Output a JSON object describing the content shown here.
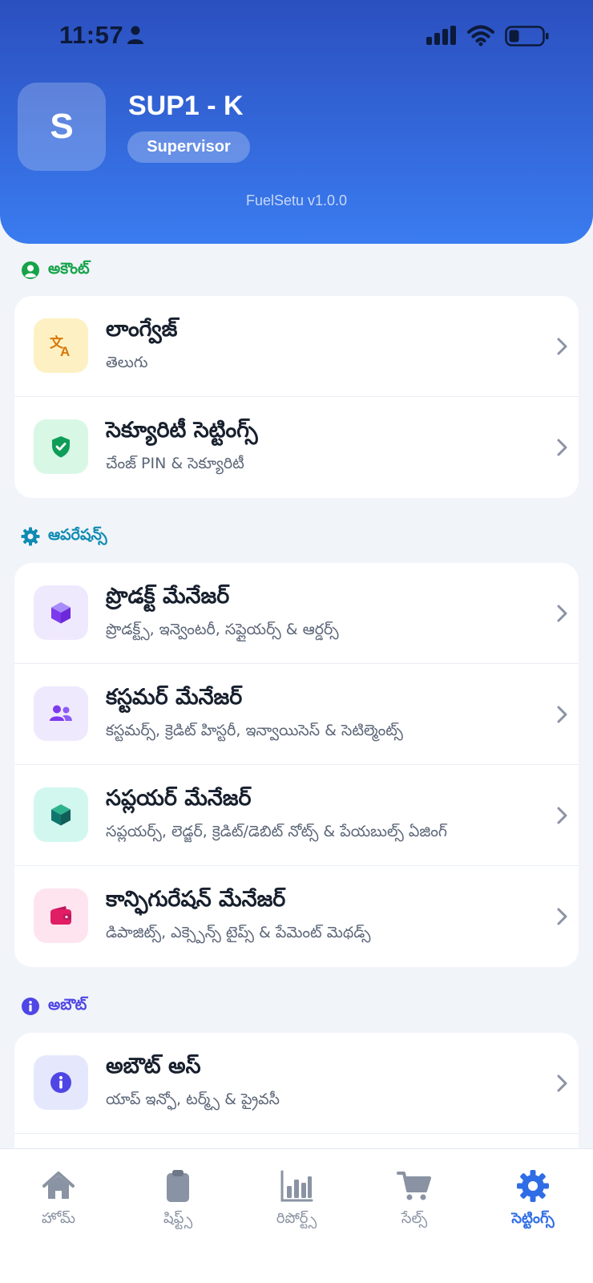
{
  "status_bar": {
    "time": "11:57"
  },
  "profile": {
    "initial": "S",
    "name": "SUP1 - K",
    "role": "Supervisor",
    "version": "FuelSetu v1.0.0"
  },
  "sections": {
    "account": {
      "title": "అకౌంట్",
      "color": "#16a34a",
      "items": [
        {
          "title": "లాంగ్వేజ్",
          "subtitle": "తెలుగు",
          "icon": "translate-icon"
        },
        {
          "title": "సెక్యూరిటీ సెట్టింగ్స్",
          "subtitle": "చేంజ్ PIN & సెక్యూరిటీ",
          "icon": "shield-check-icon"
        }
      ]
    },
    "operations": {
      "title": "ఆపరేషన్స్",
      "color": "#0f8bb3",
      "items": [
        {
          "title": "ప్రొడక్ట్ మేనేజర్",
          "subtitle": "ప్రొడక్ట్స్, ఇన్వెంటరీ, సప్లైయర్స్ & ఆర్డర్స్",
          "icon": "cube-icon"
        },
        {
          "title": "కస్టమర్ మేనేజర్",
          "subtitle": "కస్టమర్స్, క్రెడిట్ హిస్టరీ, ఇన్వాయిసెస్ & సెటిల్మెంట్స్",
          "icon": "users-icon"
        },
        {
          "title": "సప్లయర్ మేనేజర్",
          "subtitle": "సప్లయర్స్, లెడ్జర్, క్రెడిట్/డెబిట్ నోట్స్ & పేయబుల్స్ ఏజింగ్",
          "icon": "box-icon"
        },
        {
          "title": "కాన్ఫిగురేషన్ మేనేజర్",
          "subtitle": "డిపాజిట్స్, ఎక్స్పెన్స్ టైప్స్ & పేమెంట్ మెథడ్స్",
          "icon": "wallet-icon"
        }
      ]
    },
    "about": {
      "title": "అబౌట్",
      "color": "#4f46e5",
      "items": [
        {
          "title": "అబౌట్ అస్",
          "subtitle": "యాప్ ఇన్ఫో, టర్మ్స్ & ప్రైవసీ",
          "icon": "info-icon"
        }
      ]
    }
  },
  "nav": {
    "items": [
      {
        "label": "హోమ్",
        "icon": "home-icon"
      },
      {
        "label": "షిఫ్ట్స్",
        "icon": "clipboard-icon"
      },
      {
        "label": "రిపోర్ట్స్",
        "icon": "bar-chart-icon"
      },
      {
        "label": "సేల్స్",
        "icon": "cart-icon"
      },
      {
        "label": "సెట్టింగ్స్",
        "icon": "gear-icon",
        "active": true
      }
    ],
    "active_color": "#2f6de6",
    "inactive_color": "#8a93a3"
  }
}
